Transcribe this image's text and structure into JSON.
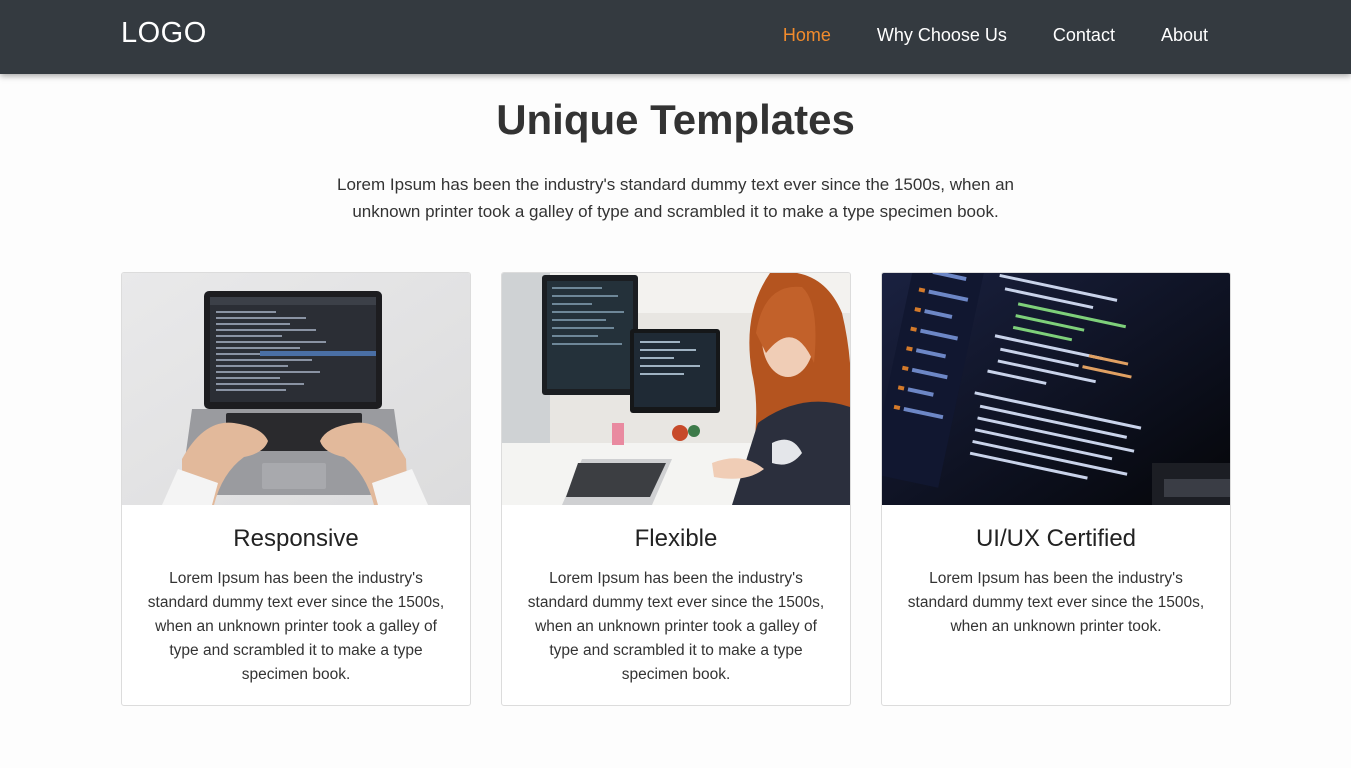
{
  "header": {
    "logo": "LOGO",
    "nav": [
      {
        "label": "Home",
        "active": true
      },
      {
        "label": "Why Choose Us"
      },
      {
        "label": "Contact"
      },
      {
        "label": "About"
      }
    ],
    "accent_color": "#f28b2c",
    "bg_color": "#343a40"
  },
  "section": {
    "title": "Unique Templates",
    "subtitle": "Lorem Ipsum has been the industry's standard dummy text ever since the 1500s, when an unknown printer took a galley of type and scrambled it to make a type specimen book."
  },
  "cards": [
    {
      "title": "Responsive",
      "text": "Lorem Ipsum has been the industry's standard dummy text ever since the 1500s, when an unknown printer took a galley of type and scrambled it to make a type specimen book."
    },
    {
      "title": "Flexible",
      "text": "Lorem Ipsum has been the industry's standard dummy text ever since the 1500s, when an unknown printer took a galley of type and scrambled it to make a type specimen book."
    },
    {
      "title": "UI/UX Certified",
      "text": "Lorem Ipsum has been the industry's standard dummy text ever since the 1500s, when an unknown printer took."
    }
  ]
}
